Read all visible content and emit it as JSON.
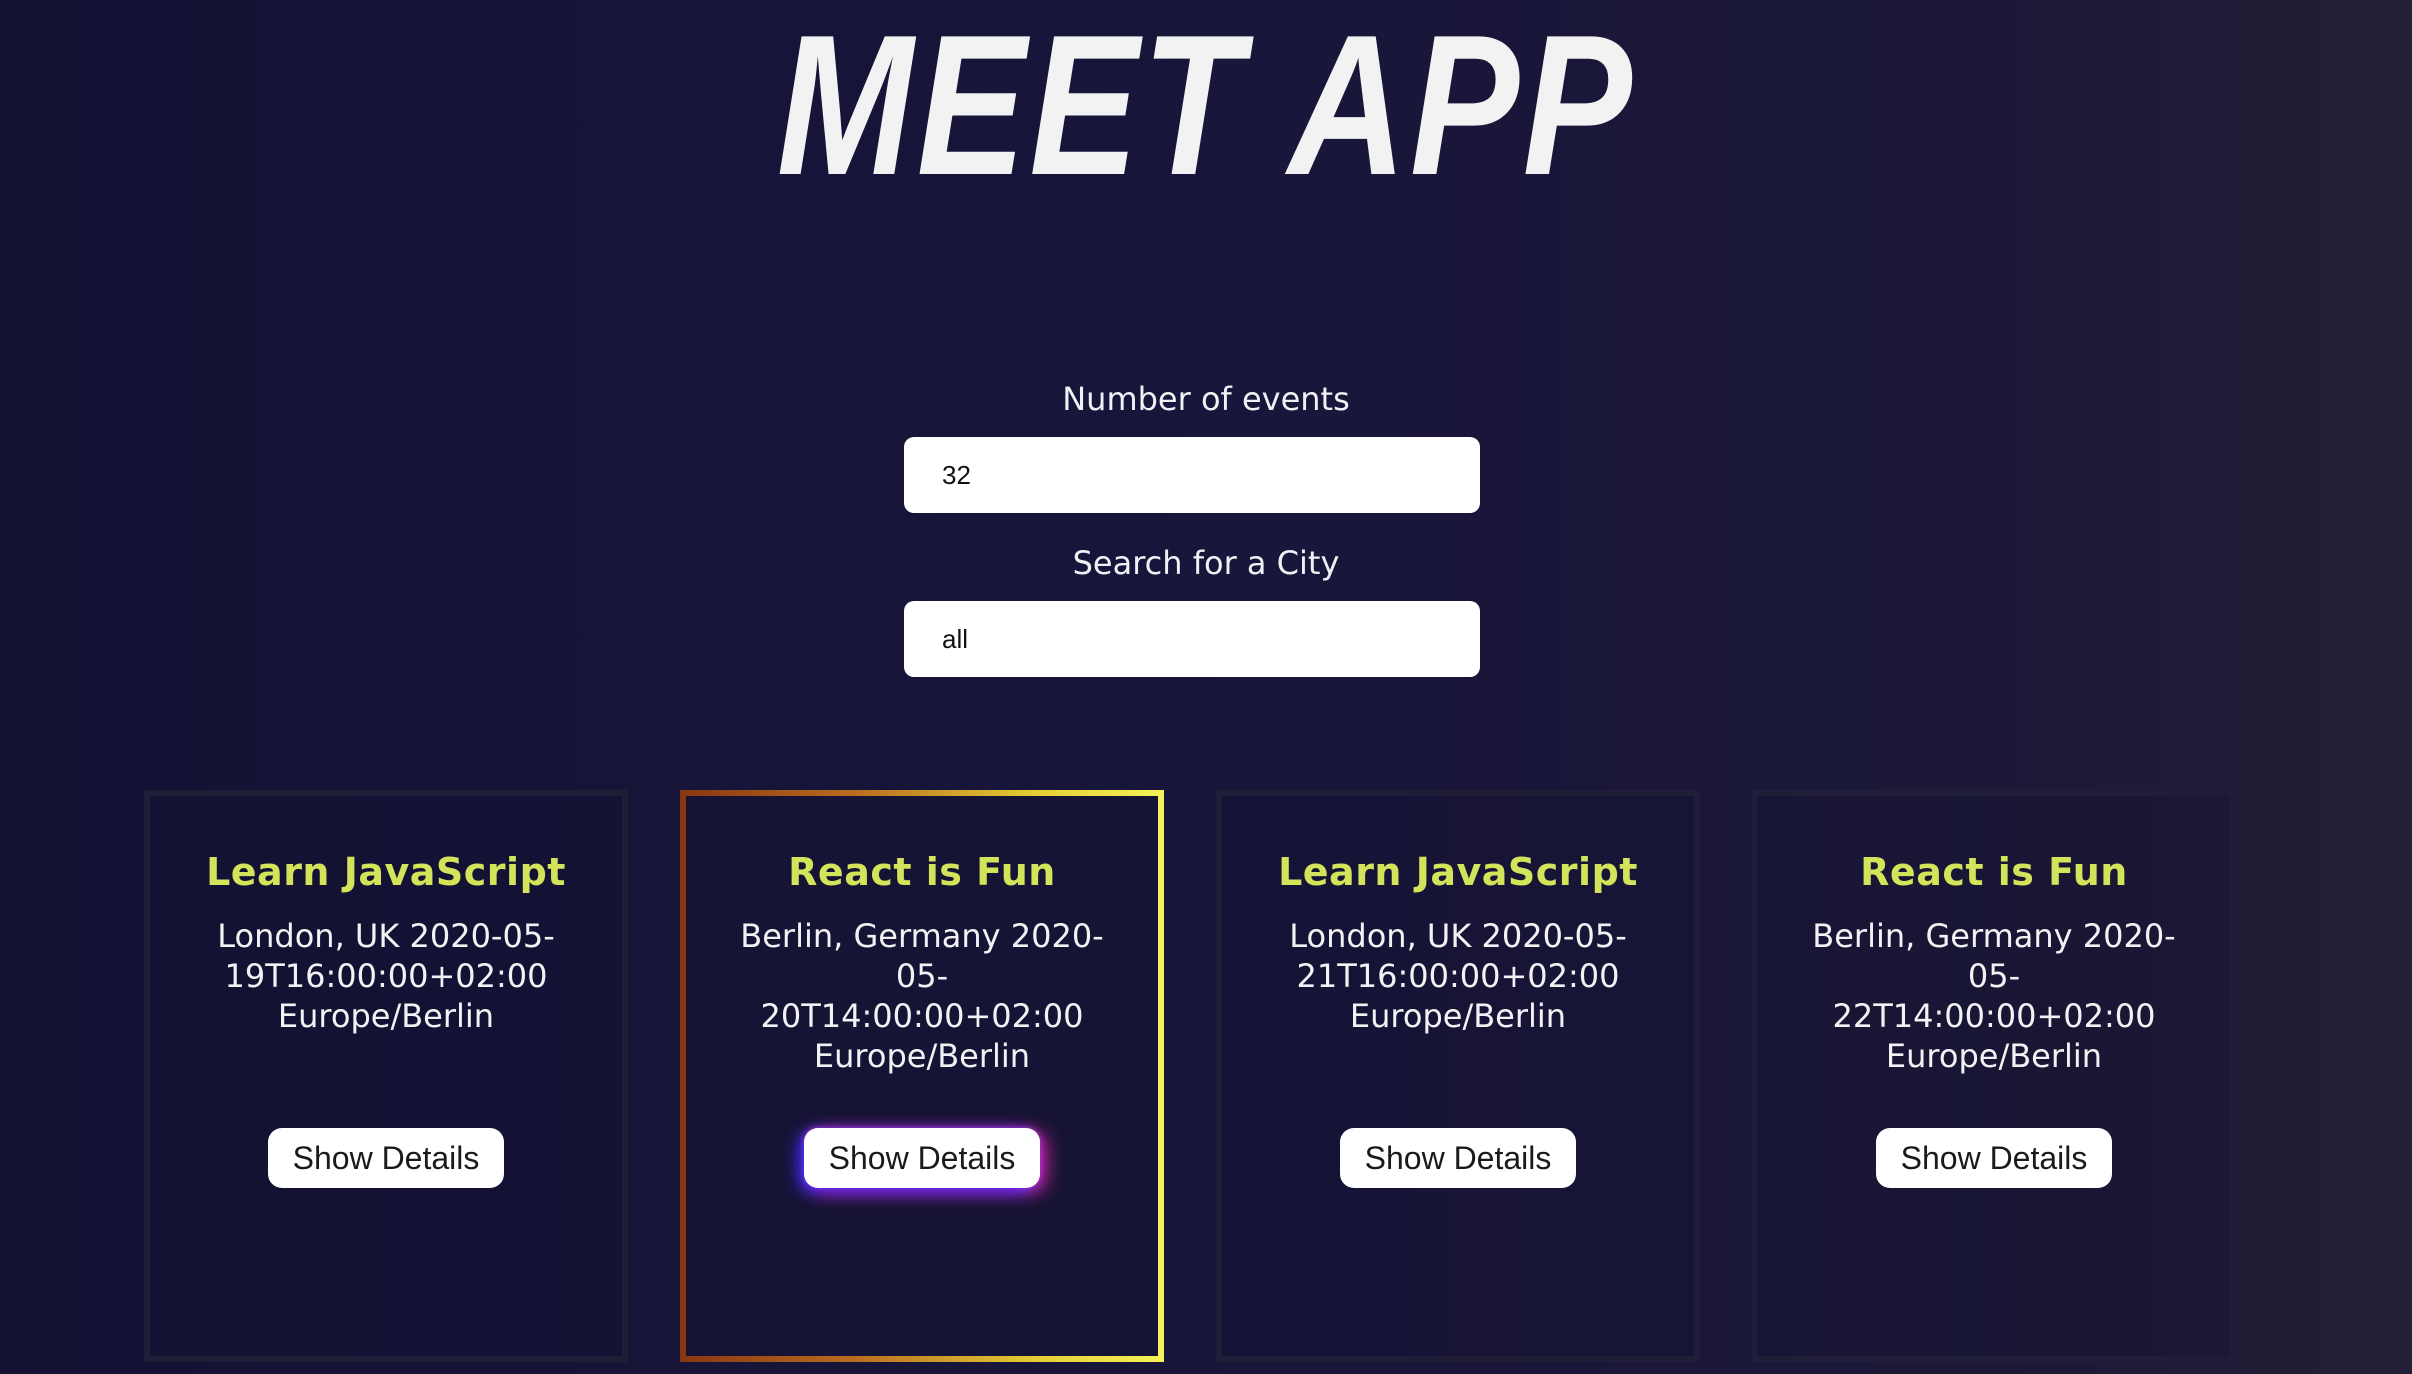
{
  "header": {
    "title": "MEET APP"
  },
  "form": {
    "number_label": "Number of events",
    "number_value": "32",
    "city_label": "Search for a City",
    "city_value": "all"
  },
  "events": [
    {
      "title": "Learn JavaScript",
      "location_date": "London, UK 2020-05-",
      "time": "19T16:00:00+02:00",
      "timezone": "Europe/Berlin",
      "button_label": "Show Details"
    },
    {
      "title": "React is Fun",
      "location_date": "Berlin, Germany 2020-05-",
      "time": "20T14:00:00+02:00",
      "timezone": "Europe/Berlin",
      "button_label": "Show Details"
    },
    {
      "title": "Learn JavaScript",
      "location_date": "London, UK 2020-05-",
      "time": "21T16:00:00+02:00",
      "timezone": "Europe/Berlin",
      "button_label": "Show Details"
    },
    {
      "title": "React is Fun",
      "location_date": "Berlin, Germany 2020-05-",
      "time": "22T14:00:00+02:00",
      "timezone": "Europe/Berlin",
      "button_label": "Show Details"
    }
  ],
  "colors": {
    "background": "#17153a",
    "card_title": "#d3e45a",
    "highlight_border_start": "#8b3512",
    "highlight_border_end": "#f6f25a"
  }
}
